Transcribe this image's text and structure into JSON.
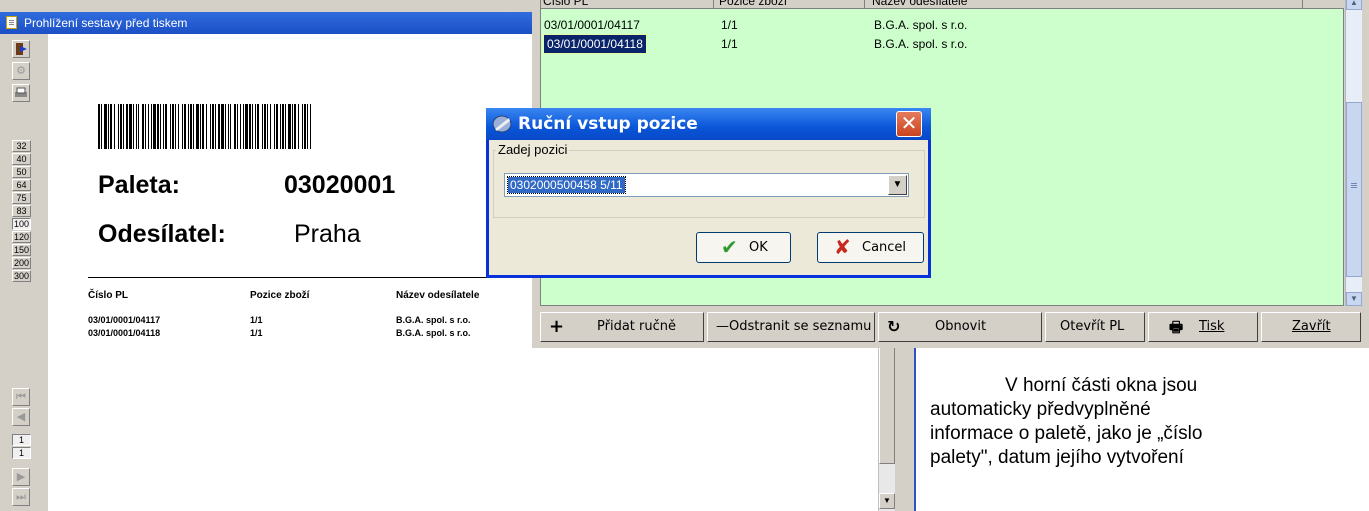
{
  "preview": {
    "title": "Prohlížení sestavy před tiskem",
    "zoom_levels": [
      "32",
      "40",
      "50",
      "64",
      "75",
      "83",
      "100",
      "120",
      "150",
      "200",
      "300"
    ],
    "active_zoom": "100",
    "page_numbers": [
      "1",
      "1"
    ],
    "report": {
      "pallet_label": "Paleta:",
      "pallet_value": "03020001",
      "sender_label": "Odesílatel:",
      "sender_value": "Praha",
      "columns": [
        "Číslo PL",
        "Pozice zboží",
        "Název odesílatele"
      ],
      "rows": [
        [
          "03/01/0001/04117",
          "1/1",
          "B.G.A. spol. s r.o."
        ],
        [
          "03/01/0001/04118",
          "1/1",
          "B.G.A. spol. s r.o."
        ]
      ]
    }
  },
  "list": {
    "columns": [
      "Číslo PL",
      "Pozice zboží",
      "Název odesílatele"
    ],
    "rows": [
      [
        "03/01/0001/04117",
        "1/1",
        "B.G.A. spol. s r.o."
      ],
      [
        "03/01/0001/04118",
        "1/1",
        "B.G.A. spol. s r.o."
      ]
    ],
    "background_color": "#ccffcc",
    "buttons": {
      "add": "Přidat ručně",
      "remove": "Odstranit se seznamu",
      "refresh": "Obnovit",
      "open": "Otevřít PL",
      "print": "Tisk",
      "close": "Zavřít"
    }
  },
  "dialog": {
    "title": "Ruční vstup pozice",
    "group_label": "Zadej pozici",
    "combo_value": "0302000500458  5/11",
    "ok": "OK",
    "cancel": "Cancel"
  },
  "doc": {
    "lines": [
      "V horní části okna jsou",
      "automaticky předvyplněné",
      "informace o paletě, jako je „číslo",
      "palety\", datum jejího vytvoření"
    ]
  }
}
